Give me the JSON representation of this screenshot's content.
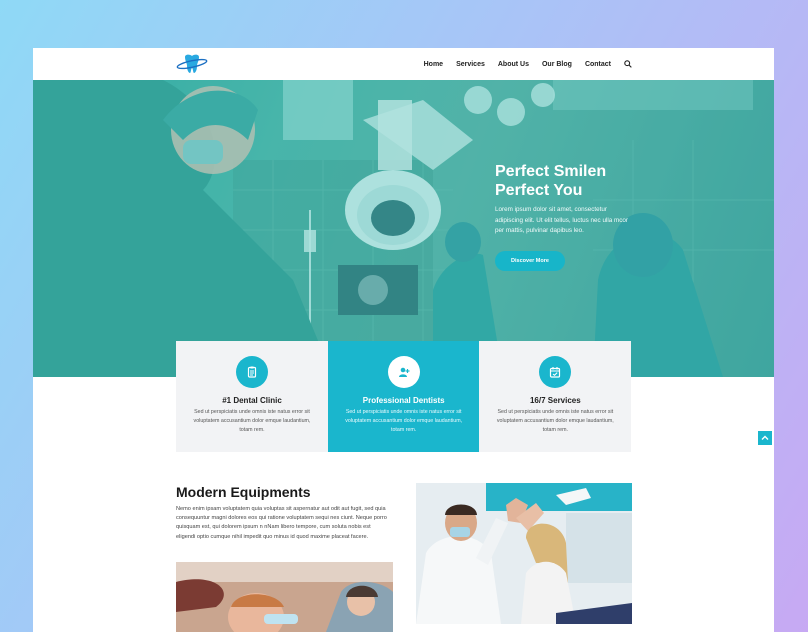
{
  "nav": {
    "items": [
      "Home",
      "Services",
      "About Us",
      "Our Blog",
      "Contact"
    ]
  },
  "hero": {
    "title_line1": "Perfect Smilen",
    "title_line2": "Perfect You",
    "text": "Lorem ipsum dolor sit amet, consectetur adipiscing elit. Ut elit tellus, luctus nec ulla mcor per mattis, pulvinar dapibus leo.",
    "button": "Discover More"
  },
  "cards": [
    {
      "icon": "clipboard-icon",
      "title": "#1 Dental Clinic",
      "text": "Sed ut perspiciatis unde omnis iste natus error sit voluptatem accusantium dolor emque laudantium, totam rem."
    },
    {
      "icon": "add-user-icon",
      "title": "Professional Dentists",
      "text": "Sed ut perspiciatis unde omnis iste natus error sit voluptatem accusantium dolor emque laudantium, totam rem."
    },
    {
      "icon": "calendar-check-icon",
      "title": "16/7 Services",
      "text": "Sed ut perspiciatis unde omnis iste natus error sit voluptatem accusantium dolor emque laudantium, totam rem."
    }
  ],
  "equipment": {
    "title": "Modern Equipments",
    "text": "Nemo enim ipsam voluptatem quia voluptas sit aspernatur aut odit aut fugit, sed quia consequuntur magni dolores eos qui ratione voluptatem sequi nes ciunt. Neque porro quisquam est, qui dolorem ipsum n nNam libero tempore, cum soluta nobis est eligendi optio cumque nihil impedit quo minus id quod maxime placeat facere."
  },
  "colors": {
    "accent": "#1ab6cd",
    "card_bg": "#f2f3f5",
    "hero_tint": "#3fb1a8"
  }
}
